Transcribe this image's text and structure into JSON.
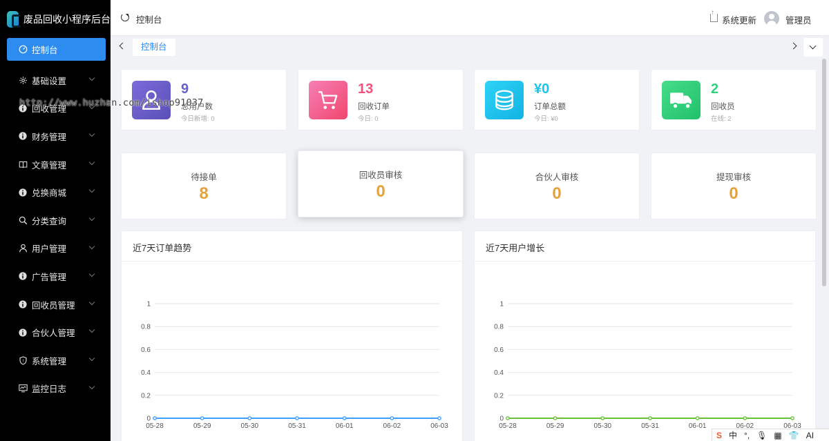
{
  "app": {
    "title": "废品回收小程序后台"
  },
  "sidebar": {
    "items": [
      {
        "label": "控制台",
        "icon": "dashboard-icon",
        "active": true
      },
      {
        "label": "基础设置",
        "icon": "gear-icon"
      },
      {
        "label": "回收管理",
        "icon": "info-icon"
      },
      {
        "label": "财务管理",
        "icon": "info-icon"
      },
      {
        "label": "文章管理",
        "icon": "book-icon"
      },
      {
        "label": "兑换商城",
        "icon": "info-icon"
      },
      {
        "label": "分类查询",
        "icon": "search-icon"
      },
      {
        "label": "用户管理",
        "icon": "user-icon"
      },
      {
        "label": "广告管理",
        "icon": "info-icon"
      },
      {
        "label": "回收员管理",
        "icon": "info-icon"
      },
      {
        "label": "合伙人管理",
        "icon": "info-icon"
      },
      {
        "label": "系统管理",
        "icon": "shield-icon"
      },
      {
        "label": "监控日志",
        "icon": "monitor-icon"
      }
    ]
  },
  "watermark": {
    "text": "http://www.huzhan.com/ishop91037"
  },
  "header": {
    "title": "控制台",
    "system_update": "系统更新",
    "user": "管理员"
  },
  "tabs": {
    "active": "控制台"
  },
  "stats": [
    {
      "value": "9",
      "label": "总用户数",
      "sub": "今日新增: 0",
      "color": "#6a60c9",
      "icon": "user-icon"
    },
    {
      "value": "13",
      "label": "回收订单",
      "sub": "今日: 0",
      "color": "#f1527a",
      "icon": "cart-icon"
    },
    {
      "value": "¥0",
      "label": "订单总额",
      "sub": "今日: ¥0",
      "color": "#19c5e8",
      "icon": "coins-icon"
    },
    {
      "value": "2",
      "label": "回收员",
      "sub": "在线: 2",
      "color": "#32d17a",
      "icon": "truck-icon"
    }
  ],
  "counts": [
    {
      "label": "待接单",
      "value": "8"
    },
    {
      "label": "回收员审核",
      "value": "0"
    },
    {
      "label": "合伙人审核",
      "value": "0"
    },
    {
      "label": "提现审核",
      "value": "0"
    }
  ],
  "chart_data": [
    {
      "type": "line",
      "title": "近7天订单趋势",
      "x": [
        "05-28",
        "05-29",
        "05-30",
        "05-31",
        "06-01",
        "06-02",
        "06-03"
      ],
      "values": [
        0,
        0,
        0,
        0,
        0,
        0,
        0
      ],
      "ylim": [
        0,
        1
      ],
      "yticks": [
        "0",
        "0.2",
        "0.4",
        "0.6",
        "0.8",
        "1"
      ],
      "color": "#409eff",
      "grid": true
    },
    {
      "type": "line",
      "title": "近7天用户增长",
      "x": [
        "05-28",
        "05-29",
        "05-30",
        "05-31",
        "06-01",
        "06-02",
        "06-03"
      ],
      "values": [
        0,
        0,
        0,
        0,
        0,
        0,
        0
      ],
      "ylim": [
        0,
        1
      ],
      "yticks": [
        "0",
        "0.2",
        "0.4",
        "0.6",
        "0.8",
        "1"
      ],
      "color": "#67c23a",
      "grid": true
    }
  ],
  "ime": {
    "items": [
      "S",
      "中",
      "°,",
      "🎙",
      "▦",
      "👕",
      "AI"
    ]
  }
}
